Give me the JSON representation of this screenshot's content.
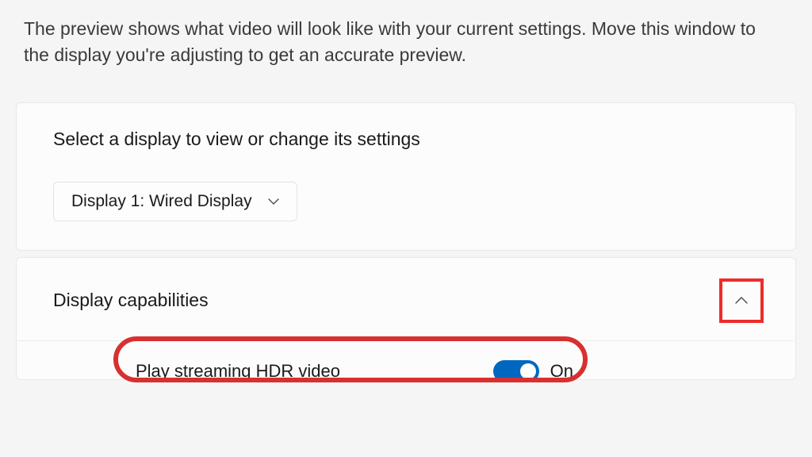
{
  "description": "The preview shows what video will look like with your current settings. Move this window to the display you're adjusting to get an accurate preview.",
  "selectDisplay": {
    "label": "Select a display to view or change its settings",
    "dropdown": {
      "selected": "Display 1: Wired Display"
    }
  },
  "capabilities": {
    "title": "Display capabilities",
    "hdr": {
      "label": "Play streaming HDR video",
      "toggleState": "On"
    }
  }
}
